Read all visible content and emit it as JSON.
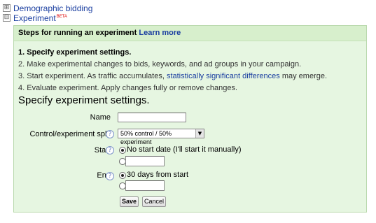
{
  "sections": {
    "demographic": {
      "toggle": "⊞",
      "label": "Demographic bidding"
    },
    "experiment": {
      "toggle": "⊟",
      "label": "Experiment",
      "badge": "BETA"
    }
  },
  "panel": {
    "title": "Steps for running an experiment",
    "learn_more": "Learn more",
    "steps": [
      "1. Specify experiment settings.",
      "2. Make experimental changes to bids, keywords, and ad groups in your campaign.",
      "3. Start experiment. As traffic accumulates, ",
      "4. Evaluate experiment. Apply changes fully or remove changes."
    ],
    "step3_link": "statistically significant differences",
    "step3_tail": " may emerge.",
    "heading": "Specify experiment settings."
  },
  "form": {
    "name": {
      "label": "Name",
      "value": ""
    },
    "split": {
      "label": "Control/experiment split",
      "selected": "50% control / 50% experiment"
    },
    "start": {
      "label": "Start",
      "option_no_date": "No start date (I'll start it manually)",
      "date_value": ""
    },
    "end": {
      "label": "End",
      "option_default": "30 days from start",
      "date_value": ""
    },
    "help_icon": "?",
    "save_label": "Save",
    "cancel_label": "Cancel"
  }
}
